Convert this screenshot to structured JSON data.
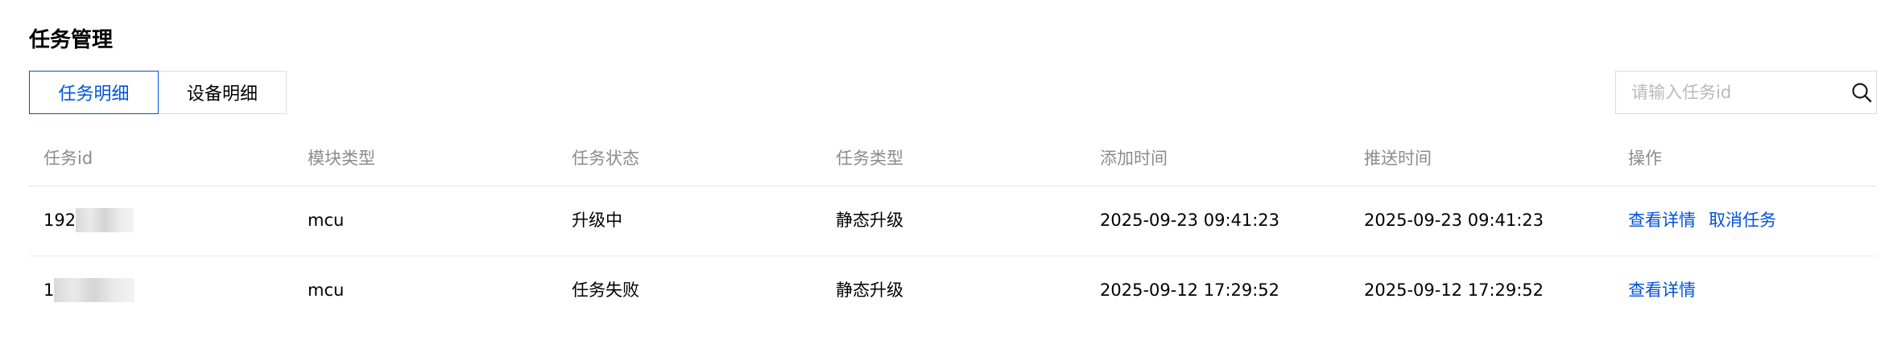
{
  "header": {
    "title": "任务管理"
  },
  "tabs": [
    {
      "label": "任务明细",
      "active": true
    },
    {
      "label": "设备明细",
      "active": false
    }
  ],
  "search": {
    "placeholder": "请输入任务id",
    "value": ""
  },
  "table": {
    "columns": [
      "任务id",
      "模块类型",
      "任务状态",
      "任务类型",
      "添加时间",
      "推送时间",
      "操作"
    ],
    "rows": [
      {
        "task_id_visible": "192",
        "module_type": "mcu",
        "status": "升级中",
        "task_type": "静态升级",
        "added_time": "2025-09-23 09:41:23",
        "push_time": "2025-09-23 09:41:23",
        "actions": [
          "查看详情",
          "取消任务"
        ]
      },
      {
        "task_id_visible": "1",
        "module_type": "mcu",
        "status": "任务失败",
        "task_type": "静态升级",
        "added_time": "2025-09-12 17:29:52",
        "push_time": "2025-09-12 17:29:52",
        "actions": [
          "查看详情"
        ]
      }
    ]
  },
  "colors": {
    "accent": "#0052d9",
    "border": "#dcdcdc",
    "header_text": "#8c8c8c",
    "placeholder": "#b9b9b9"
  },
  "icons": {
    "search": "search-icon",
    "redacted": "redacted-blur"
  }
}
